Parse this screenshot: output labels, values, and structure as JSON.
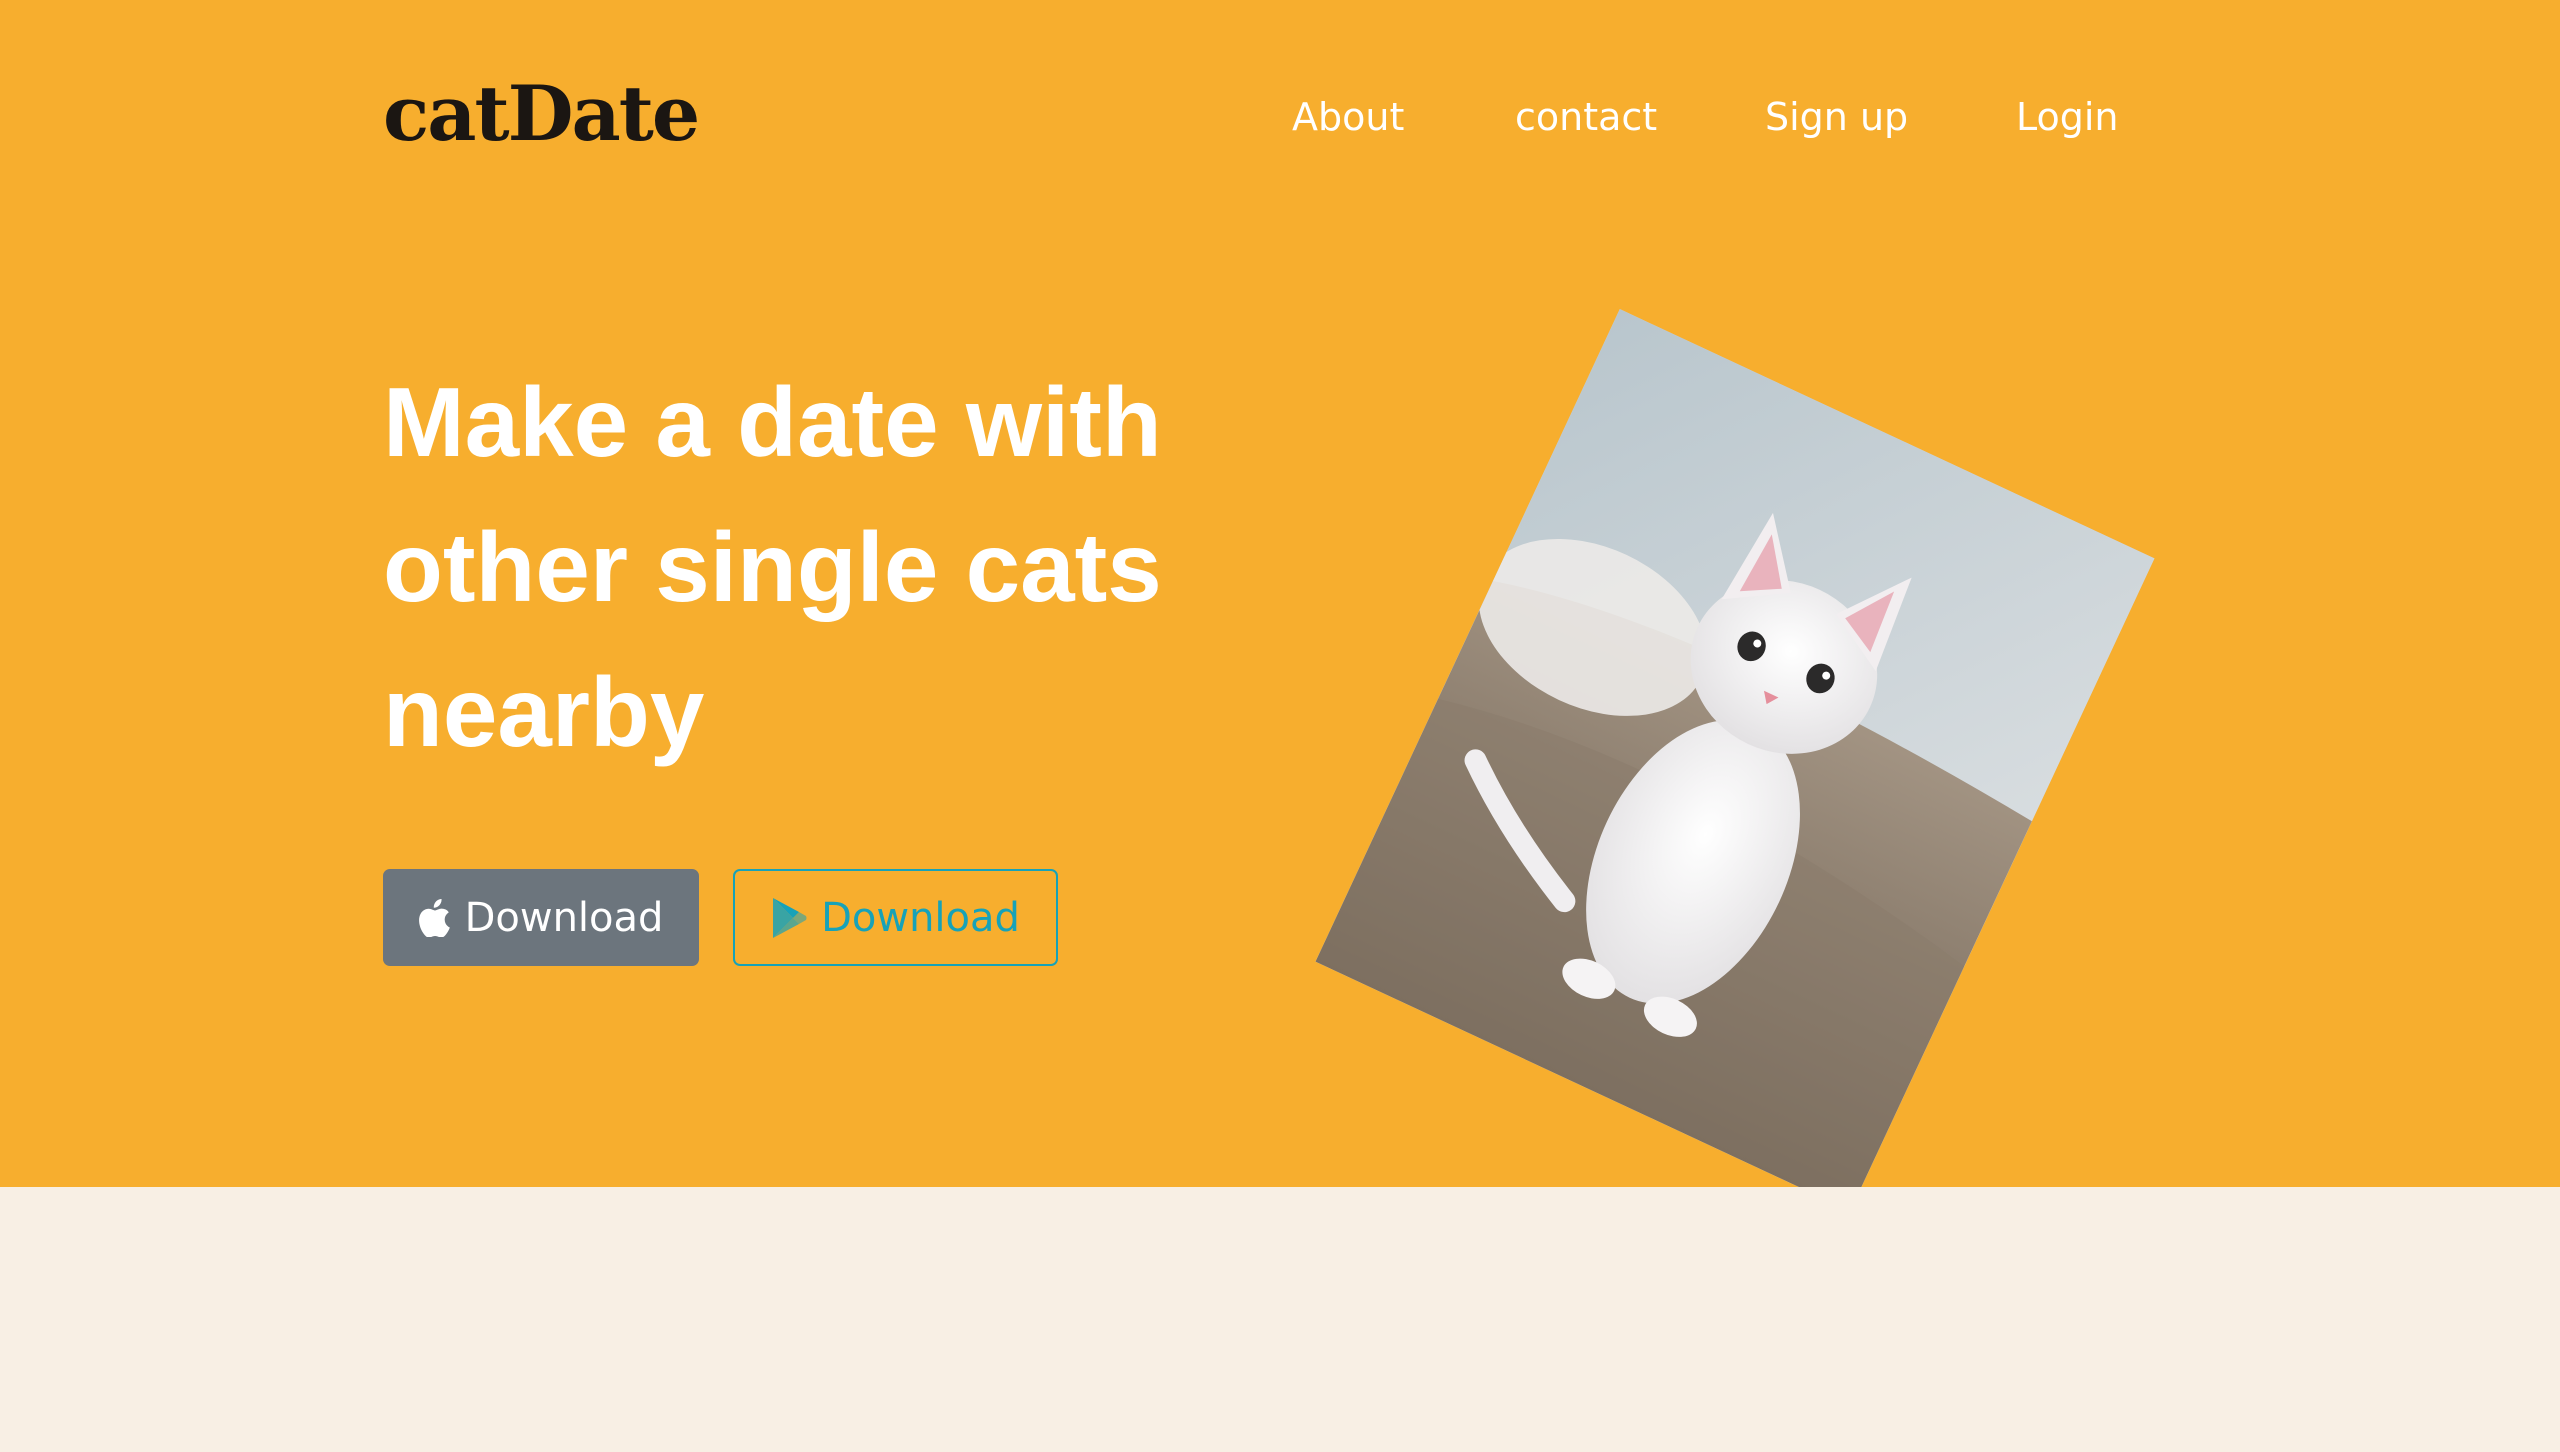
{
  "brand": {
    "name": "catDate"
  },
  "nav": {
    "items": [
      {
        "label": "About"
      },
      {
        "label": "contact"
      },
      {
        "label": "Sign up"
      },
      {
        "label": "Login"
      }
    ]
  },
  "hero": {
    "headline_lines": [
      "Make a date with",
      "other single cats",
      "nearby"
    ],
    "buttons": {
      "apple": {
        "label": "Download",
        "icon": "apple-icon"
      },
      "play": {
        "label": "Download",
        "icon": "google-play-icon"
      }
    },
    "image": {
      "subject": "white kitten sitting on sofa"
    }
  },
  "colors": {
    "hero_bg": "#f7ae2e",
    "lower_bg": "#f8efe4",
    "brand_text": "#1b1612",
    "apple_button": "#6c757d",
    "play_button": "#17a2b8"
  }
}
